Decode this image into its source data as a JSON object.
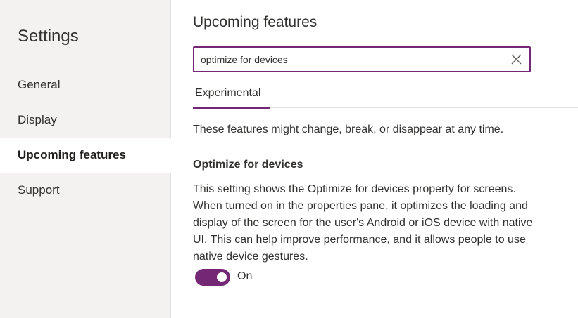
{
  "sidebar": {
    "title": "Settings",
    "items": [
      {
        "label": "General",
        "active": false
      },
      {
        "label": "Display",
        "active": false
      },
      {
        "label": "Upcoming features",
        "active": true
      },
      {
        "label": "Support",
        "active": false
      }
    ]
  },
  "main": {
    "title": "Upcoming features",
    "search": {
      "value": "optimize for devices",
      "clear_icon": "close-icon"
    },
    "tabs": [
      {
        "label": "Experimental",
        "selected": true
      }
    ],
    "description": "These features might change, break, or disappear at any time.",
    "feature": {
      "title": "Optimize for devices",
      "description": "This setting shows the Optimize for devices property for screens. When turned on in the properties pane, it optimizes the loading and display of the screen for the user's Android or iOS device with native UI. This can help improve performance, and it allows people to use native device gestures.",
      "toggle_state": "On",
      "toggle_on": true
    }
  },
  "colors": {
    "accent": "#742774",
    "sidebar_bg": "#f3f2f1",
    "text": "#323130"
  }
}
